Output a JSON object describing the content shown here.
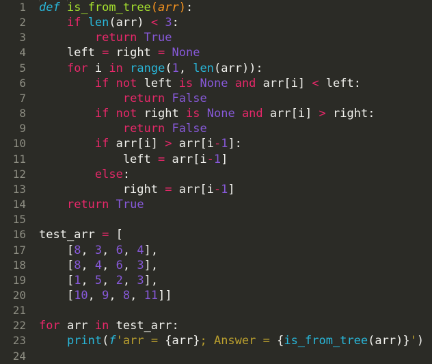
{
  "editor": {
    "background_color": "#2b2b26",
    "gutter_text_color": "#8d8d82",
    "language": "python",
    "first_line": 1,
    "last_line": 24,
    "total_lines": 24,
    "theme_colors": {
      "keyword": "#e8286a",
      "def_keyword": "#29b8db",
      "function_name": "#a6e22e",
      "parameter": "#fd971f",
      "builtin": "#29b8db",
      "number": "#8759d9",
      "constant": "#8759d9",
      "string": "#bba02e",
      "text": "#f2f2ee"
    }
  },
  "line_numbers": [
    "1",
    "2",
    "3",
    "4",
    "5",
    "6",
    "7",
    "8",
    "9",
    "10",
    "11",
    "12",
    "13",
    "14",
    "15",
    "16",
    "17",
    "18",
    "19",
    "20",
    "21",
    "22",
    "23",
    "24"
  ],
  "code": {
    "plain_text": "def is_from_tree(arr):\n    if len(arr) < 3:\n        return True\n    left = right = None\n    for i in range(1, len(arr)):\n        if not left is None and arr[i] < left:\n            return False\n        if not right is None and arr[i] > right:\n            return False\n        if arr[i] > arr[i-1]:\n            left = arr[i-1]\n        else:\n            right = arr[i-1]\n    return True\n\ntest_arr = [\n    [8, 3, 6, 4],\n    [8, 4, 6, 3],\n    [1, 5, 2, 3],\n    [10, 9, 8, 11]]\n\nfor arr in test_arr:\n    print(f'arr = {arr}; Answer = {is_from_tree(arr)}')\n",
    "lines": [
      {
        "n": "1",
        "tokens": [
          {
            "t": "def",
            "c": "defkw"
          },
          {
            "t": " ",
            "c": "plain"
          },
          {
            "t": "is_from_tree",
            "c": "fname"
          },
          {
            "t": "(",
            "c": "paren-o"
          },
          {
            "t": "arr",
            "c": "param"
          },
          {
            "t": ")",
            "c": "paren-o"
          },
          {
            "t": ":",
            "c": "plain"
          }
        ]
      },
      {
        "n": "2",
        "tokens": [
          {
            "t": "    ",
            "c": "plain"
          },
          {
            "t": "if",
            "c": "kw"
          },
          {
            "t": " ",
            "c": "plain"
          },
          {
            "t": "len",
            "c": "builtin"
          },
          {
            "t": "(arr) ",
            "c": "plain"
          },
          {
            "t": "<",
            "c": "op"
          },
          {
            "t": " ",
            "c": "plain"
          },
          {
            "t": "3",
            "c": "num"
          },
          {
            "t": ":",
            "c": "plain"
          }
        ]
      },
      {
        "n": "3",
        "tokens": [
          {
            "t": "        ",
            "c": "plain"
          },
          {
            "t": "return",
            "c": "kw"
          },
          {
            "t": " ",
            "c": "plain"
          },
          {
            "t": "True",
            "c": "const"
          }
        ]
      },
      {
        "n": "4",
        "tokens": [
          {
            "t": "    left ",
            "c": "plain"
          },
          {
            "t": "=",
            "c": "op"
          },
          {
            "t": " right ",
            "c": "plain"
          },
          {
            "t": "=",
            "c": "op"
          },
          {
            "t": " ",
            "c": "plain"
          },
          {
            "t": "None",
            "c": "const"
          }
        ]
      },
      {
        "n": "5",
        "tokens": [
          {
            "t": "    ",
            "c": "plain"
          },
          {
            "t": "for",
            "c": "kw"
          },
          {
            "t": " i ",
            "c": "plain"
          },
          {
            "t": "in",
            "c": "kw"
          },
          {
            "t": " ",
            "c": "plain"
          },
          {
            "t": "range",
            "c": "builtin"
          },
          {
            "t": "(",
            "c": "plain"
          },
          {
            "t": "1",
            "c": "num"
          },
          {
            "t": ", ",
            "c": "plain"
          },
          {
            "t": "len",
            "c": "builtin"
          },
          {
            "t": "(arr)):",
            "c": "plain"
          }
        ]
      },
      {
        "n": "6",
        "tokens": [
          {
            "t": "        ",
            "c": "plain"
          },
          {
            "t": "if",
            "c": "kw"
          },
          {
            "t": " ",
            "c": "plain"
          },
          {
            "t": "not",
            "c": "kw"
          },
          {
            "t": " left ",
            "c": "plain"
          },
          {
            "t": "is",
            "c": "kw"
          },
          {
            "t": " ",
            "c": "plain"
          },
          {
            "t": "None",
            "c": "const"
          },
          {
            "t": " ",
            "c": "plain"
          },
          {
            "t": "and",
            "c": "kw"
          },
          {
            "t": " arr[i] ",
            "c": "plain"
          },
          {
            "t": "<",
            "c": "op"
          },
          {
            "t": " left:",
            "c": "plain"
          }
        ]
      },
      {
        "n": "7",
        "tokens": [
          {
            "t": "            ",
            "c": "plain"
          },
          {
            "t": "return",
            "c": "kw"
          },
          {
            "t": " ",
            "c": "plain"
          },
          {
            "t": "False",
            "c": "const"
          }
        ]
      },
      {
        "n": "8",
        "tokens": [
          {
            "t": "        ",
            "c": "plain"
          },
          {
            "t": "if",
            "c": "kw"
          },
          {
            "t": " ",
            "c": "plain"
          },
          {
            "t": "not",
            "c": "kw"
          },
          {
            "t": " right ",
            "c": "plain"
          },
          {
            "t": "is",
            "c": "kw"
          },
          {
            "t": " ",
            "c": "plain"
          },
          {
            "t": "None",
            "c": "const"
          },
          {
            "t": " ",
            "c": "plain"
          },
          {
            "t": "and",
            "c": "kw"
          },
          {
            "t": " arr[i] ",
            "c": "plain"
          },
          {
            "t": ">",
            "c": "op"
          },
          {
            "t": " right:",
            "c": "plain"
          }
        ]
      },
      {
        "n": "9",
        "tokens": [
          {
            "t": "            ",
            "c": "plain"
          },
          {
            "t": "return",
            "c": "kw"
          },
          {
            "t": " ",
            "c": "plain"
          },
          {
            "t": "False",
            "c": "const"
          }
        ]
      },
      {
        "n": "10",
        "tokens": [
          {
            "t": "        ",
            "c": "plain"
          },
          {
            "t": "if",
            "c": "kw"
          },
          {
            "t": " arr[i] ",
            "c": "plain"
          },
          {
            "t": ">",
            "c": "op"
          },
          {
            "t": " arr[i",
            "c": "plain"
          },
          {
            "t": "-",
            "c": "op"
          },
          {
            "t": "1",
            "c": "num"
          },
          {
            "t": "]:",
            "c": "plain"
          }
        ]
      },
      {
        "n": "11",
        "tokens": [
          {
            "t": "            left ",
            "c": "plain"
          },
          {
            "t": "=",
            "c": "op"
          },
          {
            "t": " arr[i",
            "c": "plain"
          },
          {
            "t": "-",
            "c": "op"
          },
          {
            "t": "1",
            "c": "num"
          },
          {
            "t": "]",
            "c": "plain"
          }
        ]
      },
      {
        "n": "12",
        "tokens": [
          {
            "t": "        ",
            "c": "plain"
          },
          {
            "t": "else",
            "c": "kw"
          },
          {
            "t": ":",
            "c": "plain"
          }
        ]
      },
      {
        "n": "13",
        "tokens": [
          {
            "t": "            right ",
            "c": "plain"
          },
          {
            "t": "=",
            "c": "op"
          },
          {
            "t": " arr[i",
            "c": "plain"
          },
          {
            "t": "-",
            "c": "op"
          },
          {
            "t": "1",
            "c": "num"
          },
          {
            "t": "]",
            "c": "plain"
          }
        ]
      },
      {
        "n": "14",
        "tokens": [
          {
            "t": "    ",
            "c": "plain"
          },
          {
            "t": "return",
            "c": "kw"
          },
          {
            "t": " ",
            "c": "plain"
          },
          {
            "t": "True",
            "c": "const"
          }
        ]
      },
      {
        "n": "15",
        "tokens": []
      },
      {
        "n": "16",
        "tokens": [
          {
            "t": "test_arr ",
            "c": "plain"
          },
          {
            "t": "=",
            "c": "op"
          },
          {
            "t": " [",
            "c": "plain"
          }
        ]
      },
      {
        "n": "17",
        "tokens": [
          {
            "t": "    [",
            "c": "plain"
          },
          {
            "t": "8",
            "c": "num"
          },
          {
            "t": ", ",
            "c": "plain"
          },
          {
            "t": "3",
            "c": "num"
          },
          {
            "t": ", ",
            "c": "plain"
          },
          {
            "t": "6",
            "c": "num"
          },
          {
            "t": ", ",
            "c": "plain"
          },
          {
            "t": "4",
            "c": "num"
          },
          {
            "t": "],",
            "c": "plain"
          }
        ]
      },
      {
        "n": "18",
        "tokens": [
          {
            "t": "    [",
            "c": "plain"
          },
          {
            "t": "8",
            "c": "num"
          },
          {
            "t": ", ",
            "c": "plain"
          },
          {
            "t": "4",
            "c": "num"
          },
          {
            "t": ", ",
            "c": "plain"
          },
          {
            "t": "6",
            "c": "num"
          },
          {
            "t": ", ",
            "c": "plain"
          },
          {
            "t": "3",
            "c": "num"
          },
          {
            "t": "],",
            "c": "plain"
          }
        ]
      },
      {
        "n": "19",
        "tokens": [
          {
            "t": "    [",
            "c": "plain"
          },
          {
            "t": "1",
            "c": "num"
          },
          {
            "t": ", ",
            "c": "plain"
          },
          {
            "t": "5",
            "c": "num"
          },
          {
            "t": ", ",
            "c": "plain"
          },
          {
            "t": "2",
            "c": "num"
          },
          {
            "t": ", ",
            "c": "plain"
          },
          {
            "t": "3",
            "c": "num"
          },
          {
            "t": "],",
            "c": "plain"
          }
        ]
      },
      {
        "n": "20",
        "tokens": [
          {
            "t": "    [",
            "c": "plain"
          },
          {
            "t": "10",
            "c": "num"
          },
          {
            "t": ", ",
            "c": "plain"
          },
          {
            "t": "9",
            "c": "num"
          },
          {
            "t": ", ",
            "c": "plain"
          },
          {
            "t": "8",
            "c": "num"
          },
          {
            "t": ", ",
            "c": "plain"
          },
          {
            "t": "11",
            "c": "num"
          },
          {
            "t": "]]",
            "c": "plain"
          }
        ]
      },
      {
        "n": "21",
        "tokens": []
      },
      {
        "n": "22",
        "tokens": [
          {
            "t": "for",
            "c": "kw"
          },
          {
            "t": " arr ",
            "c": "plain"
          },
          {
            "t": "in",
            "c": "kw"
          },
          {
            "t": " test_arr:",
            "c": "plain"
          }
        ]
      },
      {
        "n": "23",
        "tokens": [
          {
            "t": "    ",
            "c": "plain"
          },
          {
            "t": "print",
            "c": "builtin"
          },
          {
            "t": "(",
            "c": "plain"
          },
          {
            "t": "f",
            "c": "fprefix"
          },
          {
            "t": "'arr = ",
            "c": "str"
          },
          {
            "t": "{arr}",
            "c": "plain"
          },
          {
            "t": "; Answer = ",
            "c": "str"
          },
          {
            "t": "{",
            "c": "plain"
          },
          {
            "t": "is_from_tree",
            "c": "builtin"
          },
          {
            "t": "(arr)}",
            "c": "plain"
          },
          {
            "t": "'",
            "c": "str"
          },
          {
            "t": ")",
            "c": "plain"
          }
        ]
      },
      {
        "n": "24",
        "tokens": []
      }
    ]
  },
  "indent_guides": {
    "x_positions": [
      57,
      98,
      139
    ],
    "color": "#5a5a50"
  }
}
